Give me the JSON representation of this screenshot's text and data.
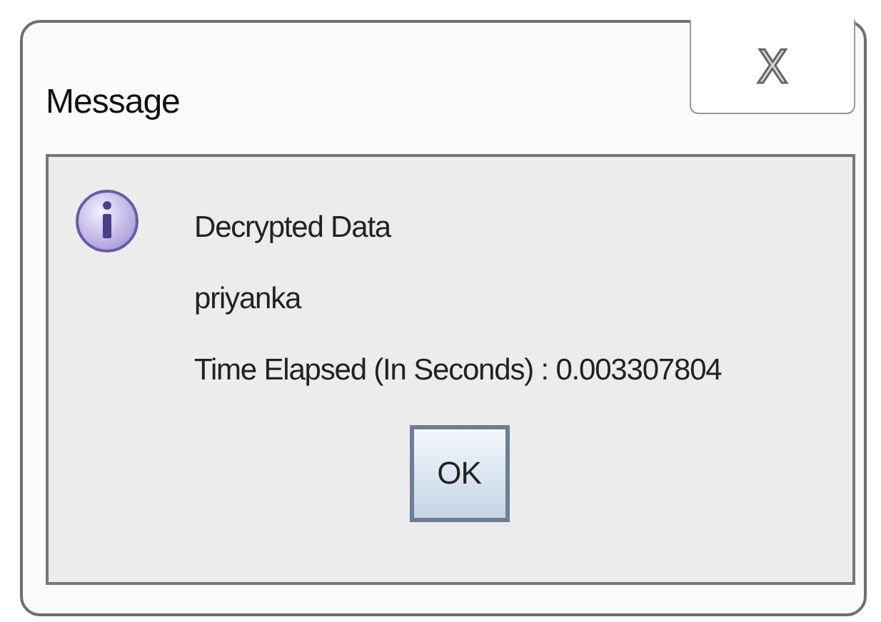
{
  "window": {
    "title": "Message",
    "close_button": "X"
  },
  "message": {
    "lines": [
      "Decrypted Data",
      "priyanka",
      "Time Elapsed (In Seconds) : 0.003307804"
    ]
  },
  "buttons": [
    "OK"
  ]
}
